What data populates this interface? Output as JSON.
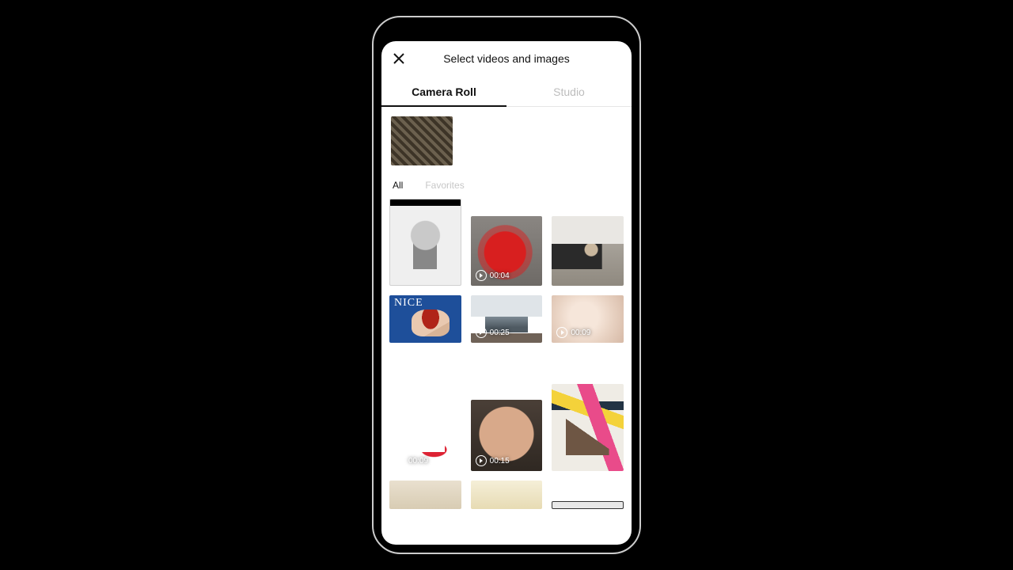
{
  "header": {
    "title": "Select videos and images"
  },
  "tabs": [
    {
      "label": "Camera Roll",
      "active": true
    },
    {
      "label": "Studio",
      "active": false
    }
  ],
  "filters": [
    {
      "label": "All",
      "active": true
    },
    {
      "label": "Favorites",
      "active": false
    }
  ],
  "grid": [
    {
      "kind": "image",
      "duration": ""
    },
    {
      "kind": "video",
      "duration": "00:04"
    },
    {
      "kind": "image",
      "duration": ""
    },
    {
      "kind": "image",
      "duration": ""
    },
    {
      "kind": "video",
      "duration": "00:25"
    },
    {
      "kind": "video",
      "duration": "00:09"
    },
    {
      "kind": "video",
      "duration": "00:09"
    },
    {
      "kind": "video",
      "duration": "00:15"
    },
    {
      "kind": "image",
      "duration": ""
    },
    {
      "kind": "image",
      "duration": ""
    },
    {
      "kind": "image",
      "duration": ""
    },
    {
      "kind": "image",
      "duration": ""
    }
  ]
}
